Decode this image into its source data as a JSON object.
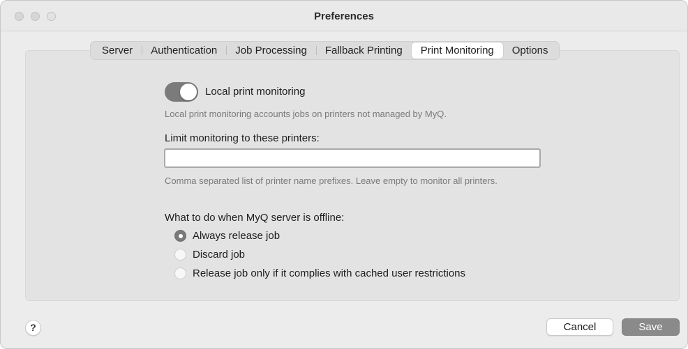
{
  "window": {
    "title": "Preferences"
  },
  "tabs": [
    {
      "label": "Server"
    },
    {
      "label": "Authentication"
    },
    {
      "label": "Job Processing"
    },
    {
      "label": "Fallback Printing"
    },
    {
      "label": "Print Monitoring",
      "active": true
    },
    {
      "label": "Options"
    }
  ],
  "monitoring": {
    "toggle_label": "Local print monitoring",
    "toggle_on": true,
    "toggle_help": "Local print monitoring accounts jobs on printers not managed by MyQ.",
    "limit_label": "Limit monitoring to these printers:",
    "limit_value": "",
    "limit_help": "Comma separated list of printer name prefixes. Leave empty to monitor all printers."
  },
  "offline": {
    "label": "What to do when MyQ server is offline:",
    "options": [
      {
        "label": "Always release job",
        "selected": true
      },
      {
        "label": "Discard job",
        "selected": false
      },
      {
        "label": "Release job only if it complies with cached user restrictions",
        "selected": false
      }
    ]
  },
  "footer": {
    "help_label": "?",
    "cancel_label": "Cancel",
    "save_label": "Save"
  },
  "colors": {
    "toggle_on": "#7b7b7b",
    "save_button": "#8a8a8a"
  }
}
